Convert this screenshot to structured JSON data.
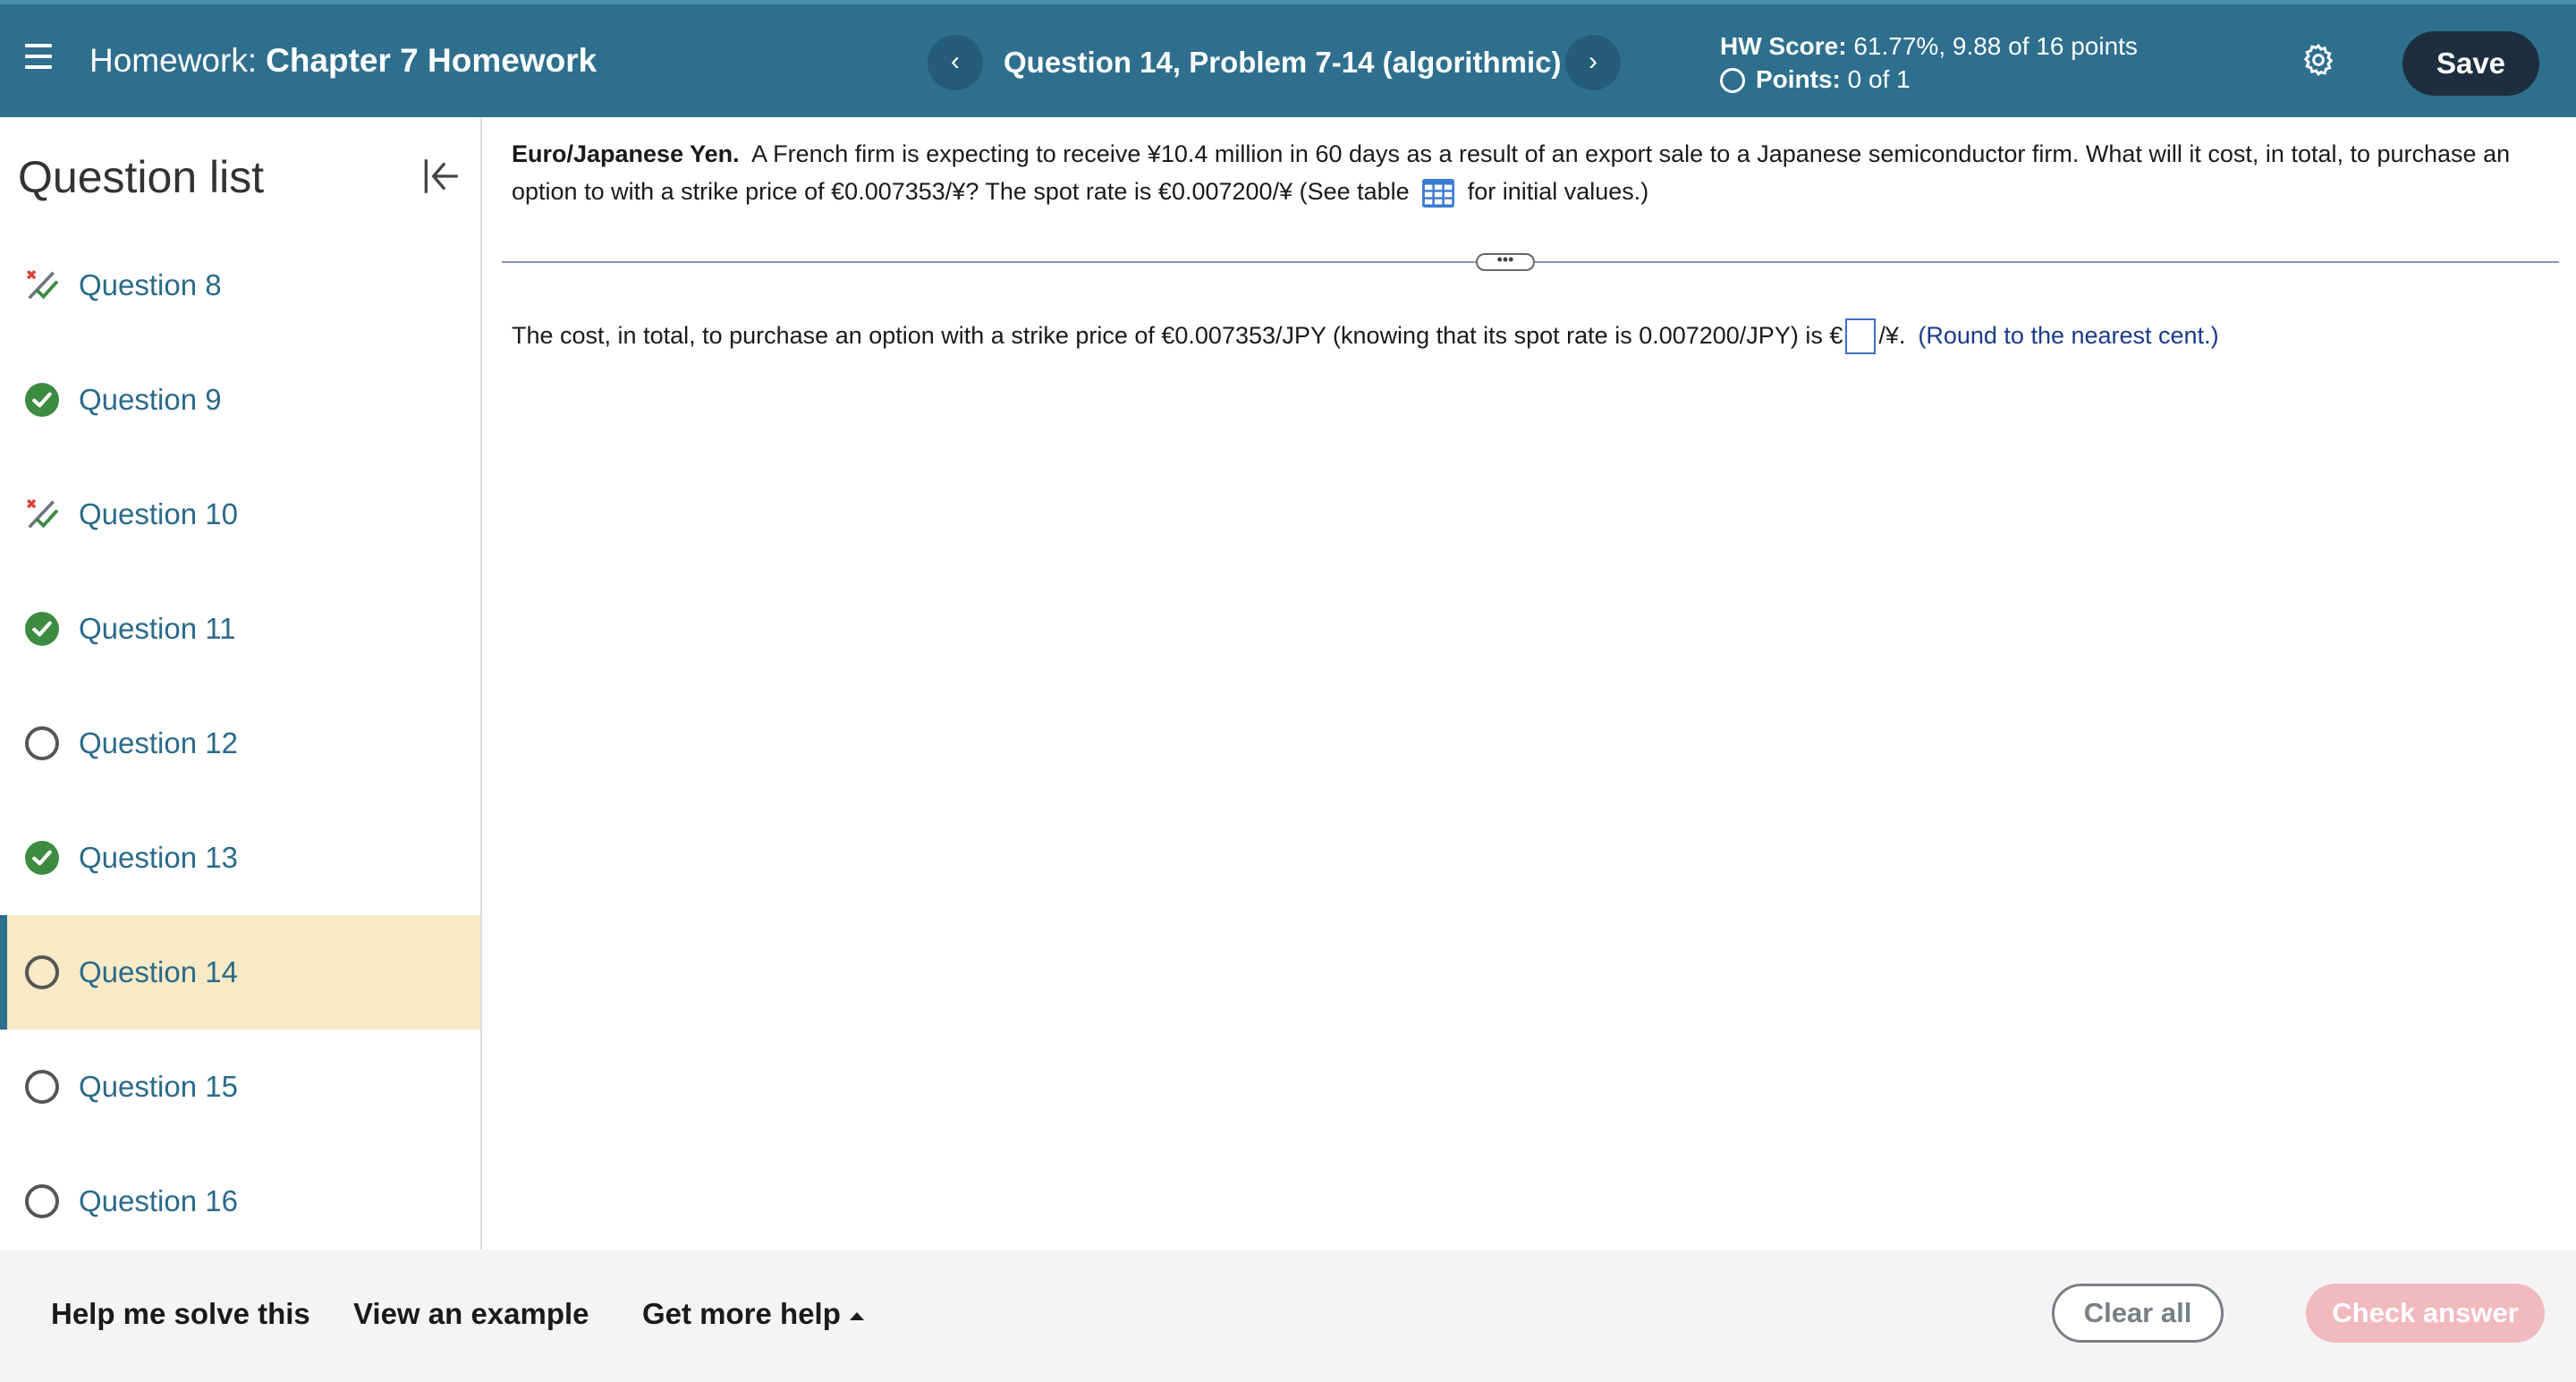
{
  "header": {
    "hw_label": "Homework:",
    "hw_name": "Chapter 7 Homework",
    "question_title": "Question 14, Problem 7-14 (algorithmic)",
    "score_label": "HW Score:",
    "score_value": "61.77%, 9.88 of 16 points",
    "points_label": "Points:",
    "points_value": "0 of 1",
    "save_label": "Save",
    "prev_glyph": "‹",
    "next_glyph": "›"
  },
  "sidebar": {
    "title": "Question list",
    "items": [
      {
        "label": "Question 8",
        "status": "partial"
      },
      {
        "label": "Question 9",
        "status": "correct"
      },
      {
        "label": "Question 10",
        "status": "partial"
      },
      {
        "label": "Question 11",
        "status": "correct"
      },
      {
        "label": "Question 12",
        "status": "open"
      },
      {
        "label": "Question 13",
        "status": "correct"
      },
      {
        "label": "Question 14",
        "status": "open",
        "active": true
      },
      {
        "label": "Question 15",
        "status": "open"
      },
      {
        "label": "Question 16",
        "status": "open"
      }
    ]
  },
  "question": {
    "heading": "Euro/Japanese Yen.",
    "text_1": "A French firm is expecting to receive ¥10.4 million in 60 days as a result of an export sale to a Japanese semiconductor firm. What will it cost, in total, to purchase an option to with a strike price of €0.007353/¥?  The spot rate is €0.007200/¥ (See table",
    "text_2": "for initial values.)",
    "divider_dots": "•••",
    "answer_prefix": "The cost, in total, to purchase an option with a strike price of €0.007353/JPY (knowing that its spot rate is 0.007200/JPY) is €",
    "answer_suffix": "/¥.",
    "round_note": "(Round to the nearest cent.)"
  },
  "footer": {
    "help_solve": "Help me solve this",
    "view_example": "View an example",
    "more_help": "Get more help",
    "clear_all": "Clear all",
    "check_answer": "Check answer"
  },
  "colors": {
    "header_bg": "#2e6f8e",
    "save_bg": "#1d2f3e",
    "correct": "#3d8b40",
    "partial_x": "#d9443c",
    "active_row": "#f8eac6",
    "check_disabled": "#f1b9c0"
  }
}
